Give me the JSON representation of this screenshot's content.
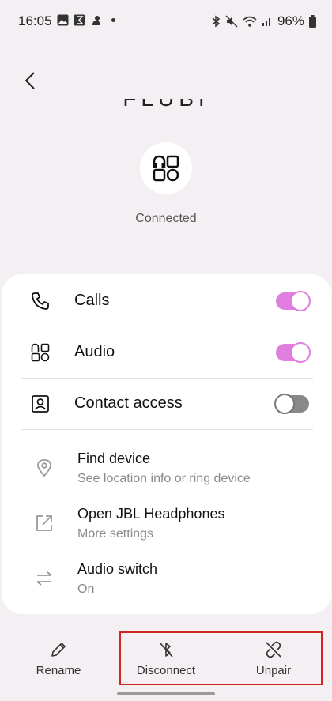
{
  "status_bar": {
    "time": "16:05",
    "left_icons": [
      "gallery-icon",
      "sigma-app-icon",
      "app-notification-icon",
      "more-dot"
    ],
    "battery": "96%",
    "right_icons": [
      "bluetooth-icon",
      "mute-icon",
      "wifi-icon",
      "signal-icon",
      "battery-icon"
    ]
  },
  "header": {
    "back_icon": "back-chevron-icon",
    "device_name_partial": "FLUBI"
  },
  "device": {
    "icon": "audio-device-icon",
    "status": "Connected"
  },
  "settings": {
    "toggles": [
      {
        "icon": "phone-icon",
        "label": "Calls",
        "state": "on"
      },
      {
        "icon": "audio-grid-icon",
        "label": "Audio",
        "state": "on"
      },
      {
        "icon": "contact-icon",
        "label": "Contact access",
        "state": "off"
      }
    ],
    "links": [
      {
        "icon": "location-pin-icon",
        "title": "Find device",
        "subtitle": "See location info or ring device"
      },
      {
        "icon": "open-external-icon",
        "title": "Open JBL Headphones",
        "subtitle": "More settings"
      },
      {
        "icon": "swap-arrows-icon",
        "title": "Audio switch",
        "subtitle": "On"
      }
    ]
  },
  "actions": {
    "rename": "Rename",
    "disconnect": "Disconnect",
    "unpair": "Unpair"
  },
  "colors": {
    "background": "#f3eff3",
    "toggle_on": "#e07ee0",
    "toggle_off": "#888888",
    "highlight": "#d32424"
  }
}
